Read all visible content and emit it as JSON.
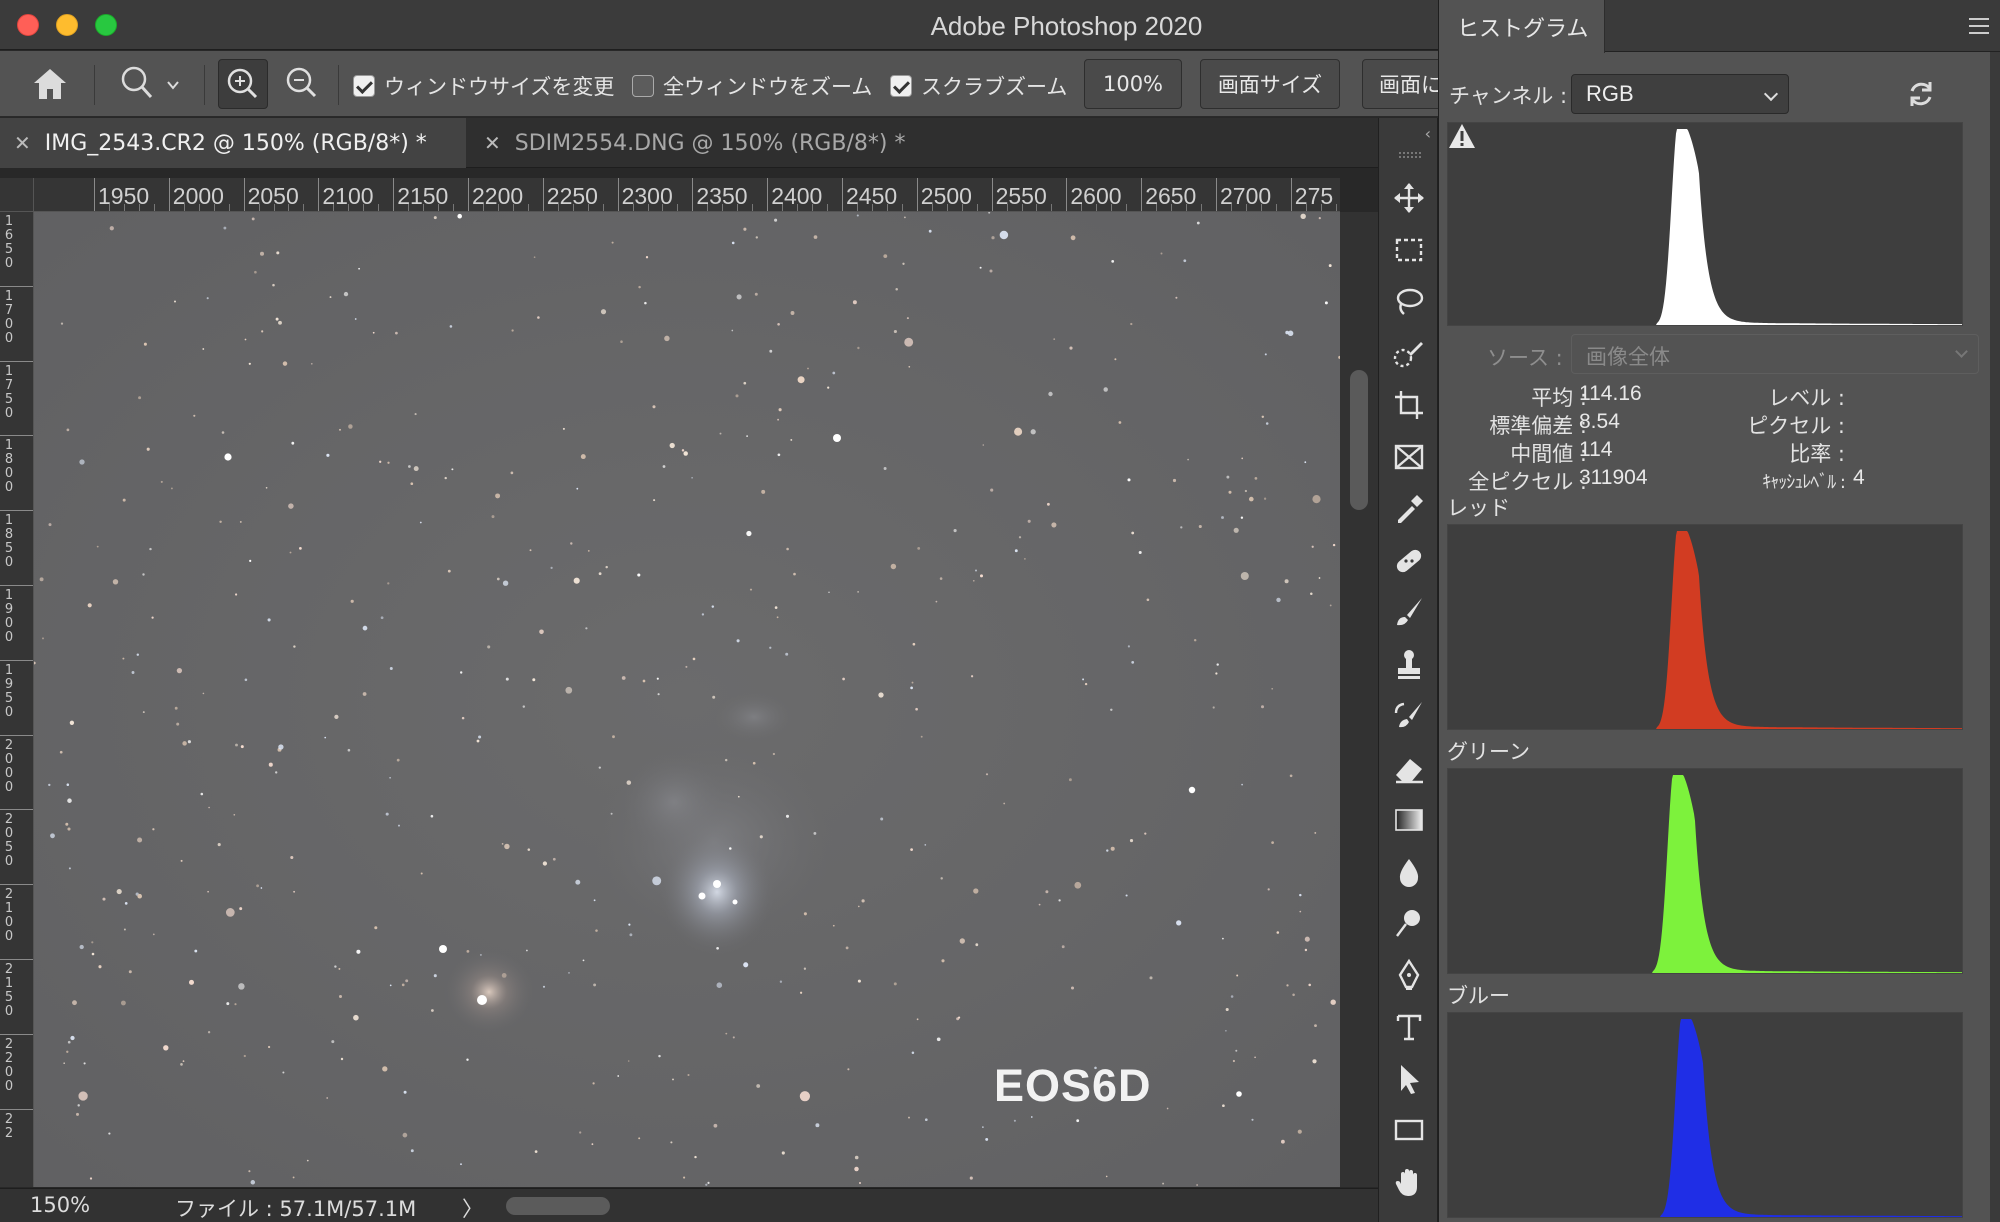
{
  "window": {
    "title": "Adobe Photoshop 2020"
  },
  "options_bar": {
    "checkbox_resize": {
      "label": "ウィンドウサイズを変更",
      "checked": true
    },
    "checkbox_zoom_all": {
      "label": "全ウィンドウをズーム",
      "checked": false
    },
    "checkbox_scrubby": {
      "label": "スクラブズーム",
      "checked": true
    },
    "btn_100": "100%",
    "btn_fit_screen": "画面サイズ",
    "btn_fill_screen": "画面に"
  },
  "tabs": [
    {
      "label": "IMG_2543.CR2 @ 150% (RGB/8*) *",
      "active": true
    },
    {
      "label": "SDIM2554.DNG @ 150% (RGB/8*) *",
      "active": false
    }
  ],
  "ruler": {
    "top_labels": [
      "1950",
      "2000",
      "2050",
      "2100",
      "2150",
      "2200",
      "2250",
      "2300",
      "2350",
      "2400",
      "2450",
      "2500",
      "2550",
      "2600",
      "2650",
      "2700",
      "275"
    ],
    "left_labels": [
      "1650",
      "1700",
      "1750",
      "1800",
      "1850",
      "1900",
      "1950",
      "2000",
      "2050",
      "2100",
      "2150",
      "2200",
      "22"
    ]
  },
  "canvas": {
    "watermark": "EOS6D"
  },
  "status_bar": {
    "zoom": "150%",
    "file_info": "ファイル : 57.1M/57.1M",
    "arrow": "〉"
  },
  "histogram_panel": {
    "tab_label": "ヒストグラム",
    "channel_label": "チャンネル :",
    "channel_value": "RGB",
    "source_label": "ソース :",
    "source_value": "画像全体",
    "stats": {
      "mean_label": "平均 :",
      "mean": "114.16",
      "std_label": "標準偏差 :",
      "std": "8.54",
      "median_label": "中間値 :",
      "median": "114",
      "pixels_label": "全ピクセル :",
      "pixels": "311904",
      "level_label": "レベル :",
      "level": "",
      "count_label": "ピクセル :",
      "count": "",
      "percentile_label": "比率 :",
      "percentile": "",
      "cache_label": "ｷｬｯｼｭﾚﾍﾞﾙ :",
      "cache": "4"
    },
    "channels": [
      {
        "name": "",
        "color": "#ffffff",
        "peak_level": 114
      },
      {
        "name": "レッド",
        "color": "#d23c22",
        "peak_level": 114
      },
      {
        "name": "グリーン",
        "color": "#7df23c",
        "peak_level": 112
      },
      {
        "name": "ブルー",
        "color": "#1f2ee6",
        "peak_level": 116
      }
    ]
  },
  "toolbar_icons": [
    "move-icon",
    "marquee-icon",
    "lasso-icon",
    "quick-select-icon",
    "crop-icon",
    "frame-icon",
    "eyedropper-icon",
    "healing-icon",
    "brush-icon",
    "stamp-icon",
    "history-brush-icon",
    "eraser-icon",
    "gradient-icon",
    "blur-icon",
    "dodge-icon",
    "pen-icon",
    "type-icon",
    "path-select-icon",
    "rectangle-icon",
    "hand-icon"
  ]
}
